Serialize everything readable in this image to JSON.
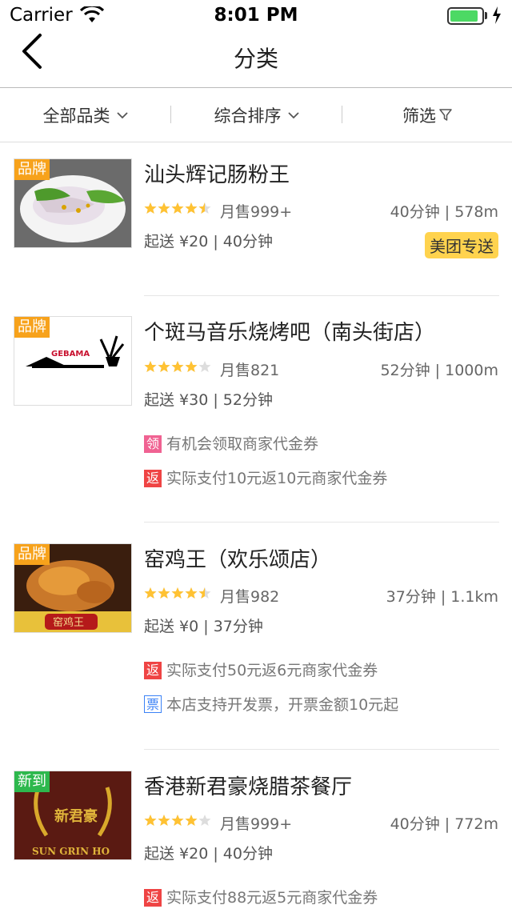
{
  "status_bar": {
    "carrier": "Carrier",
    "time": "8:01 PM",
    "battery_level": 0.9
  },
  "nav": {
    "title": "分类"
  },
  "filters": [
    {
      "label": "全部品类"
    },
    {
      "label": "综合排序"
    },
    {
      "label": "筛选"
    }
  ],
  "colors": {
    "brand_badge": "#f7a21b",
    "new_badge": "#2db84d",
    "delivery_tag": "#ffd34e",
    "star": "#ffc233",
    "promo_ling": "#f06292",
    "promo_fan": "#ef4444",
    "promo_piao": "#3b82f6"
  },
  "shops": [
    {
      "badge": "品牌",
      "name": "汕头辉记肠粉王",
      "rating": 4.5,
      "monthly_sales": "月售999+",
      "distance": "40分钟 | 578m",
      "min_order": "起送 ¥20 | 40分钟",
      "delivery_tag": "美团专送",
      "promos": []
    },
    {
      "badge": "品牌",
      "name": "个斑马音乐烧烤吧（南头街店）",
      "rating": 4,
      "monthly_sales": "月售821",
      "distance": "52分钟 | 1000m",
      "min_order": "起送 ¥30 | 52分钟",
      "thumb_text": "GEBAMA",
      "promos": [
        {
          "icon": "领",
          "text": "有机会领取商家代金券"
        },
        {
          "icon": "返",
          "text": "实际支付10元返10元商家代金券"
        }
      ]
    },
    {
      "badge": "品牌",
      "name": "窑鸡王（欢乐颂店）",
      "rating": 4.5,
      "monthly_sales": "月售982",
      "distance": "37分钟 | 1.1km",
      "min_order": "起送 ¥0 | 37分钟",
      "thumb_text": "窑鸡王",
      "promos": [
        {
          "icon": "返",
          "text": "实际支付50元返6元商家代金券"
        },
        {
          "icon": "票",
          "text": "本店支持开发票，开票金额10元起"
        }
      ]
    },
    {
      "badge": "新到",
      "name": "香港新君豪烧腊茶餐厅",
      "rating": 4,
      "monthly_sales": "月售999+",
      "distance": "40分钟 | 772m",
      "min_order": "起送 ¥20 | 40分钟",
      "thumb_text": "新君豪",
      "thumb_sub": "SUN GRIN HO",
      "promos": [
        {
          "icon": "返",
          "text": "实际支付88元返5元商家代金券"
        }
      ]
    }
  ]
}
